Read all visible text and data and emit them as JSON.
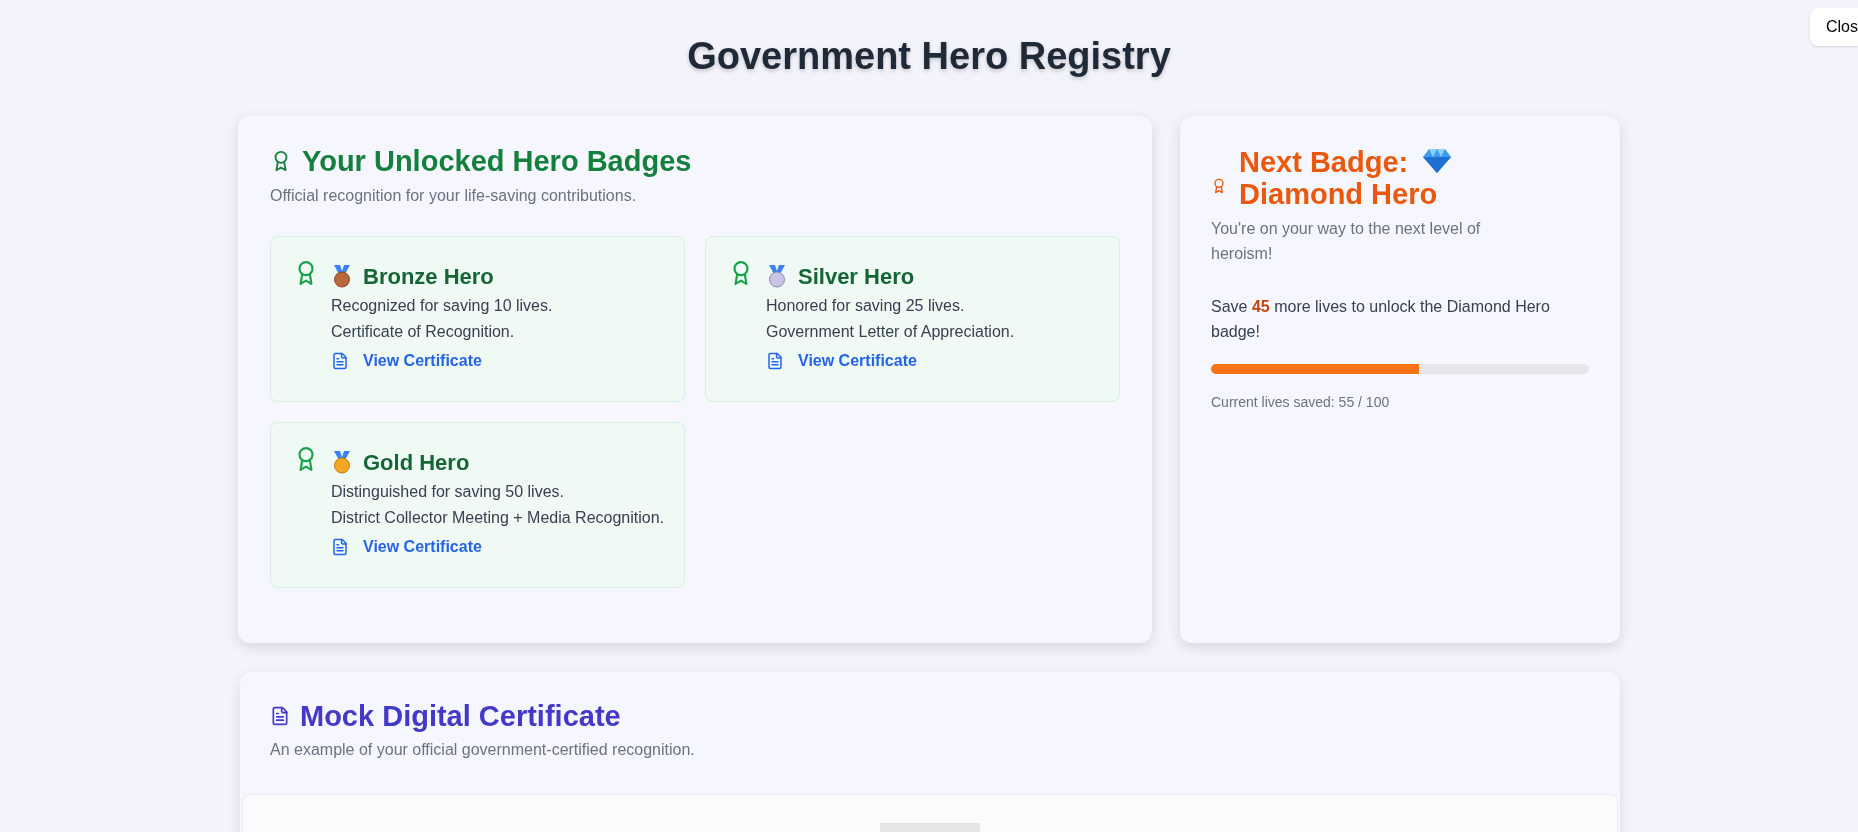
{
  "close_button": "Clos",
  "title": "Government Hero Registry",
  "badges_card": {
    "title": "Your Unlocked Hero Badges",
    "subtitle": "Official recognition for your life-saving contributions.",
    "badges": [
      {
        "kind": "bronze",
        "name": "Bronze Hero",
        "lines": [
          "Recognized for saving 10 lives.",
          "Certificate of Recognition."
        ],
        "link": "View Certificate"
      },
      {
        "kind": "silver",
        "name": "Silver Hero",
        "lines": [
          "Honored for saving 25 lives.",
          "Government Letter of Appreciation."
        ],
        "link": "View Certificate"
      },
      {
        "kind": "gold",
        "name": "Gold Hero",
        "lines": [
          "Distinguished for saving 50 lives.",
          "District Collector Meeting + Media Recognition."
        ],
        "link": "View Certificate"
      }
    ]
  },
  "next_badge": {
    "title": "Next Badge:",
    "badge_name": "Diamond Hero",
    "subtitle": "You're on your way to the next level of heroism!",
    "message": "Save **45** more lives to unlock the Diamond Hero badge!",
    "level": 0.55,
    "caption": "Current lives saved: 55 / 100"
  },
  "certificate_card": {
    "title": "Mock Digital Certificate",
    "subtitle": "An example of your official government-certified recognition."
  }
}
